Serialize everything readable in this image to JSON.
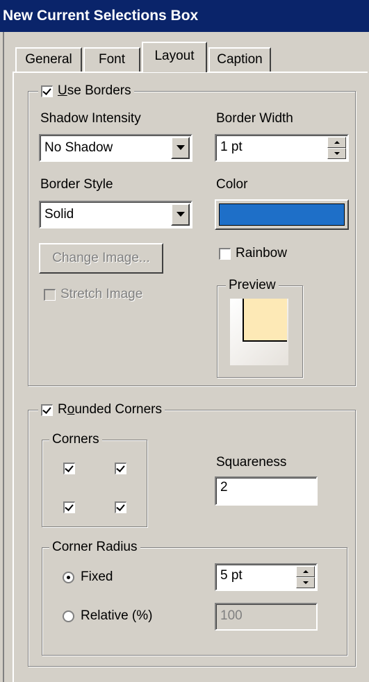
{
  "window": {
    "title": "New Current Selections Box"
  },
  "tabs": [
    {
      "label": "General"
    },
    {
      "label": "Font"
    },
    {
      "label": "Layout",
      "active": true
    },
    {
      "label": "Caption"
    }
  ],
  "borders": {
    "use_borders_label": "Use Borders",
    "use_borders_checked": true,
    "shadow_intensity_label": "Shadow Intensity",
    "shadow_intensity_value": "No Shadow",
    "border_width_label": "Border Width",
    "border_width_value": "1 pt",
    "border_style_label": "Border Style",
    "border_style_value": "Solid",
    "color_label": "Color",
    "color_value": "#1e6fc8",
    "rainbow_label": "Rainbow",
    "rainbow_checked": false,
    "change_image_label": "Change Image...",
    "stretch_image_label": "Stretch Image",
    "stretch_image_checked": false,
    "preview_label": "Preview",
    "preview_fill_color": "#fde9b6"
  },
  "rounded": {
    "rounded_corners_label": "Rounded Corners",
    "rounded_corners_checked": true,
    "corners_label": "Corners",
    "corners_checked": [
      true,
      true,
      true,
      true
    ],
    "squareness_label": "Squareness",
    "squareness_value": "2",
    "corner_radius_label": "Corner Radius",
    "fixed_label": "Fixed",
    "fixed_selected": true,
    "fixed_value": "5 pt",
    "relative_label": "Relative (%)",
    "relative_value": "100"
  }
}
